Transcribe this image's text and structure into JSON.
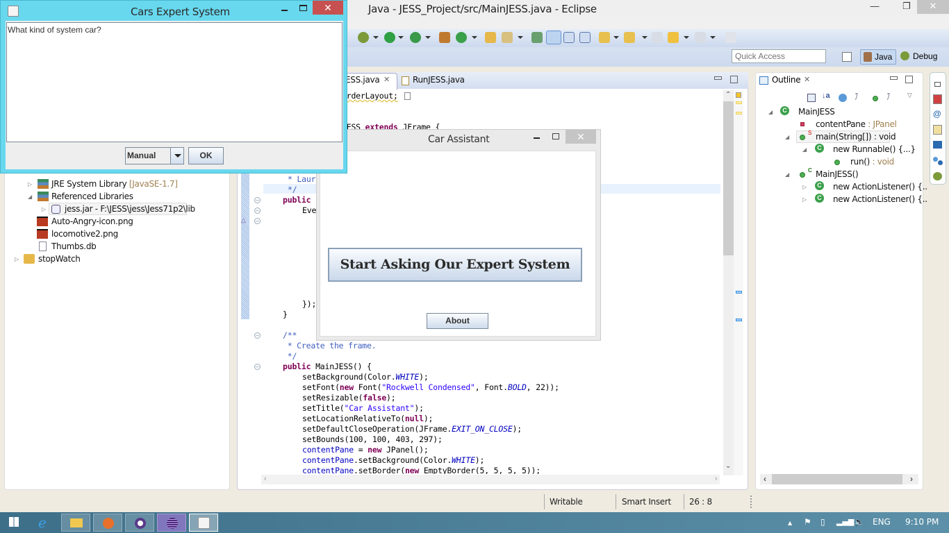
{
  "eclipse": {
    "title": "Java - JESS_Project/src/MainJESS.java - Eclipse",
    "quick_access_placeholder": "Quick Access",
    "perspectives": {
      "java": "Java",
      "debug": "Debug"
    },
    "editor_tabs": [
      {
        "label": "MainJESS.java",
        "visible_label": "ESS.java",
        "active": true
      },
      {
        "label": "RunJESS.java",
        "active": false
      }
    ],
    "code_lines": {
      "l1": "orderLayout;",
      "l2a": "JESS ",
      "l2b": "extends",
      "l2c": " JFrame {",
      "l3": "* Laur",
      "l4": "*/",
      "l5": "public",
      "l6": "Eve",
      "l7": "});",
      "l8": "}",
      "l9": "/**",
      "l10": " * Create the frame.",
      "l11": " */",
      "l12a": "public",
      "l12b": " MainJESS() {",
      "l13a": "setBackground(Color.",
      "l13b": "WHITE",
      "l13c": ");",
      "l14a": "setFont(",
      "l14b": "new",
      "l14c": " Font(",
      "l14d": "\"Rockwell Condensed\"",
      "l14e": ", Font.",
      "l14f": "BOLD",
      "l14g": ", 22));",
      "l15a": "setResizable(",
      "l15b": "false",
      "l15c": ");",
      "l16a": "setTitle(",
      "l16b": "\"Car Assistant\"",
      "l16c": ");",
      "l17a": "setLocationRelativeTo(",
      "l17b": "null",
      "l17c": ");",
      "l18a": "setDefaultCloseOperation(JFrame.",
      "l18b": "EXIT_ON_CLOSE",
      "l18c": ");",
      "l19": "setBounds(100, 100, 403, 297);",
      "l20a": "contentPane",
      "l20b": " = ",
      "l20c": "new",
      "l20d": " JPanel();",
      "l21a": "contentPane",
      "l21b": ".setBackground(Color.",
      "l21c": "WHITE",
      "l21d": ");",
      "l22a": "contentPane",
      "l22b": ".setBorder(",
      "l22c": "new",
      "l22d": " EmptyBorder(5, 5, 5, 5));"
    },
    "package_explorer": [
      {
        "label": "JRE System Library",
        "suffix": "[JavaSE-1.7]"
      },
      {
        "label": "Referenced Libraries"
      },
      {
        "label": "jess.jar - F:\\JESS\\jess\\Jess71p2\\lib"
      },
      {
        "label": "Auto-Angry-icon.png"
      },
      {
        "label": "locomotive2.png"
      },
      {
        "label": "Thumbs.db"
      },
      {
        "label": "stopWatch"
      }
    ],
    "outline": {
      "title": "Outline",
      "items": [
        {
          "label": "MainJESS",
          "type": ""
        },
        {
          "label": "contentPane",
          "type": " : JPanel"
        },
        {
          "label": "main(String[])",
          "type": " : void"
        },
        {
          "label": "new Runnable() {...}",
          "type": ""
        },
        {
          "label": "run()",
          "type": " : void"
        },
        {
          "label": "MainJESS()",
          "type": ""
        },
        {
          "label": "new ActionListener() {..",
          "type": ""
        },
        {
          "label": "new ActionListener() {..",
          "type": ""
        }
      ]
    },
    "status": {
      "writable": "Writable",
      "insert_mode": "Smart Insert",
      "position": "26 : 8"
    }
  },
  "cars_expert_dialog": {
    "title": "Cars Expert System",
    "question": "What kind of system car?",
    "select_value": "Manual",
    "ok_label": "OK"
  },
  "car_assistant": {
    "title": "Car Assistant",
    "start_button": "Start Asking Our Expert System",
    "about_button": "About"
  },
  "taskbar": {
    "language": "ENG",
    "time": "9:10 PM"
  }
}
